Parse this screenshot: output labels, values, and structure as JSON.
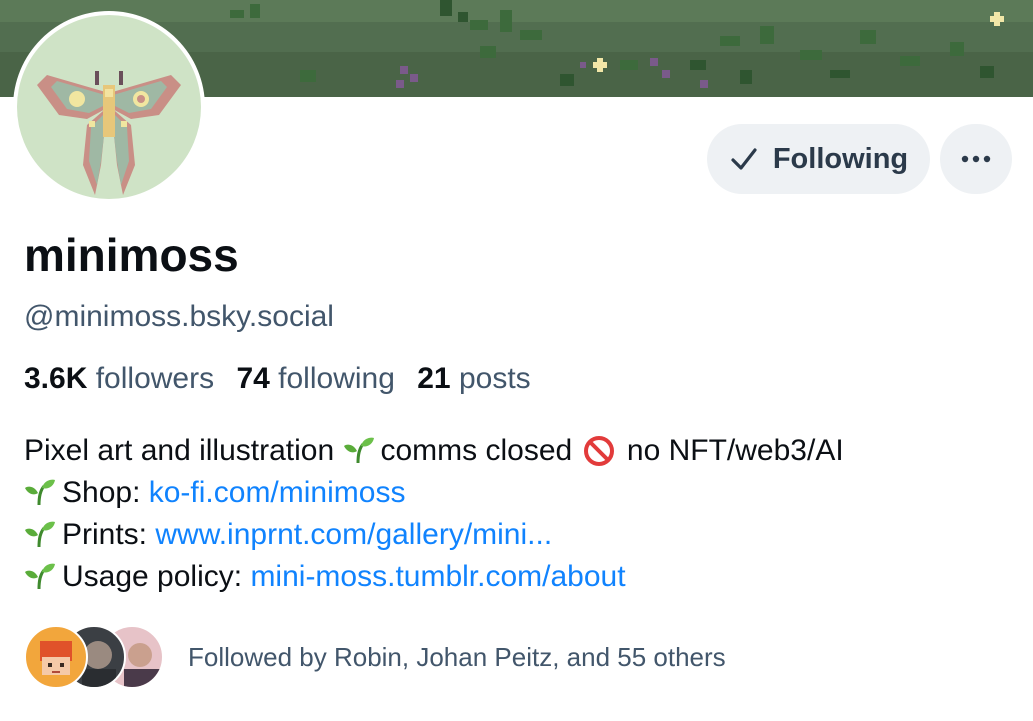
{
  "profile": {
    "display_name": "minimoss",
    "handle": "@minimoss.bsky.social",
    "stats": {
      "followers_count": "3.6K",
      "followers_label": "followers",
      "following_count": "74",
      "following_label": "following",
      "posts_count": "21",
      "posts_label": "posts"
    },
    "bio": {
      "line1_a": "Pixel art and illustration",
      "line1_b": "comms closed",
      "line1_c": "no NFT/web3/AI",
      "shop_label": "Shop:",
      "shop_link": "ko-fi.com/minimoss",
      "prints_label": "Prints:",
      "prints_link": "www.inprnt.com/gallery/mini...",
      "usage_label": "Usage policy:",
      "usage_link": "mini-moss.tumblr.com/about"
    },
    "followed_by": "Followed by Robin, Johan Peitz, and 55 others"
  },
  "actions": {
    "following_label": "Following",
    "more_icon": "ellipsis-icon"
  },
  "icons": {
    "check": "check-icon",
    "sprout": "sprout-emoji",
    "no_entry": "no-entry-emoji"
  },
  "colors": {
    "link": "#1083fe",
    "muted_text": "#42566b",
    "button_bg": "#eef1f4",
    "avatar_bg": "#cfe3c6"
  }
}
